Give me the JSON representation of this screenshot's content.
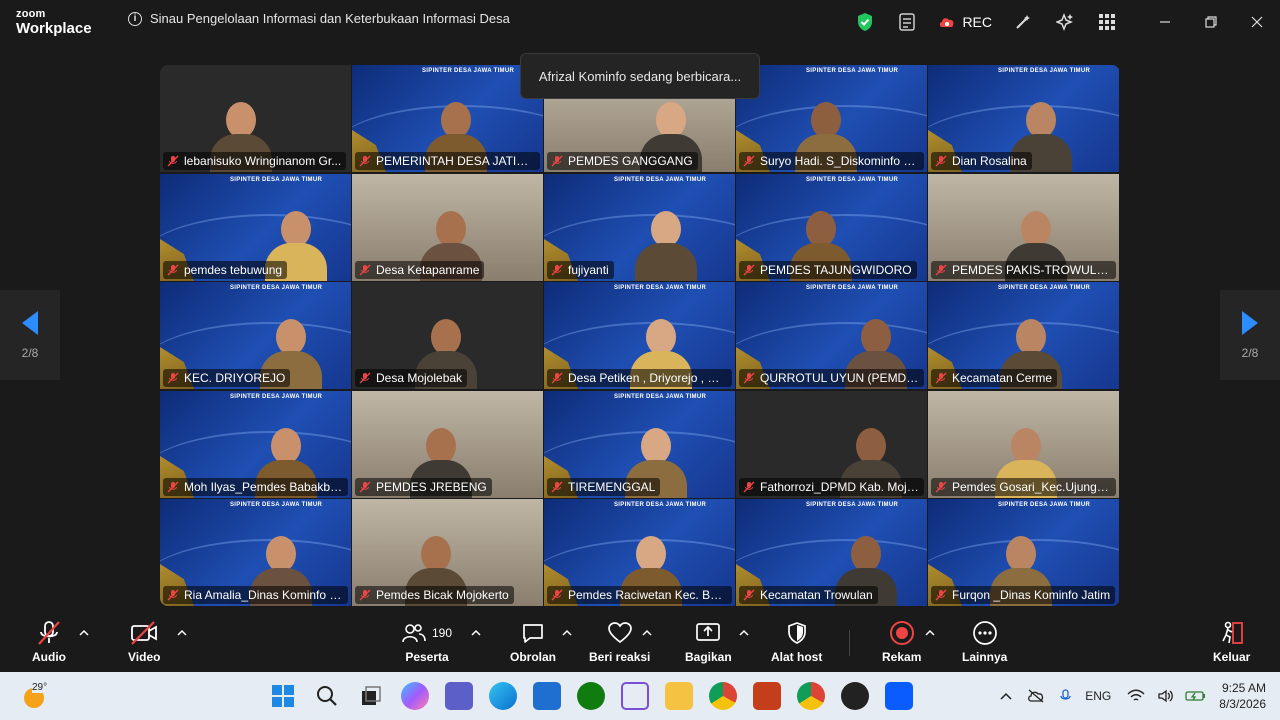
{
  "app": {
    "logo_line1": "zoom",
    "logo_line2": "Workplace",
    "meeting_title": "Sinau Pengelolaan Informasi dan Keterbukaan Informasi Desa",
    "rec_label": "REC",
    "accent_green": "#22c55e",
    "rec_red": "#ef4444"
  },
  "speaker_toast": "Afrizal Kominfo sedang berbicara...",
  "pager": {
    "left_count": "2/8",
    "right_count": "2/8"
  },
  "tile_banner": "SIPINTER DESA JAWA TIMUR",
  "tiles": [
    {
      "name": "lebanisuko Wringinanom Gr...",
      "bg": "dark"
    },
    {
      "name": "PEMERINTAH DESA JATIPAS...",
      "bg": "blue"
    },
    {
      "name": "PEMDES GANGGANG",
      "bg": "room"
    },
    {
      "name": "Suryo Hadi. S_Diskominfo K...",
      "bg": "blue"
    },
    {
      "name": "Dian Rosalina",
      "bg": "blue"
    },
    {
      "name": "pemdes tebuwung",
      "bg": "blue"
    },
    {
      "name": "Desa Ketapanrame",
      "bg": "room"
    },
    {
      "name": "fujiyanti",
      "bg": "blue"
    },
    {
      "name": "PEMDES TAJUNGWIDORO",
      "bg": "blue"
    },
    {
      "name": "PEMDES PAKIS-TROWULAN",
      "bg": "room"
    },
    {
      "name": "KEC. DRIYOREJO",
      "bg": "blue"
    },
    {
      "name": "Desa Mojolebak",
      "bg": "dark"
    },
    {
      "name": "Desa Petiken , Driyorejo , Gr...",
      "bg": "blue"
    },
    {
      "name": "QURROTUL UYUN (PEMDES ...",
      "bg": "blue"
    },
    {
      "name": "Kecamatan Cerme",
      "bg": "blue"
    },
    {
      "name": "Moh Ilyas_Pemdes Babakba...",
      "bg": "blue"
    },
    {
      "name": "PEMDES JREBENG",
      "bg": "room"
    },
    {
      "name": "TIREMENGGAL",
      "bg": "blue"
    },
    {
      "name": "Fathorrozi_DPMD Kab. Mojo...",
      "bg": "dark"
    },
    {
      "name": "Pemdes Gosari_Kec.Ujungpa...",
      "bg": "room"
    },
    {
      "name": "Ria Amalia_Dinas Kominfo P...",
      "bg": "blue"
    },
    {
      "name": "Pemdes Bicak Mojokerto",
      "bg": "room"
    },
    {
      "name": "Pemdes Raciwetan Kec. Bun...",
      "bg": "blue"
    },
    {
      "name": "Kecamatan Trowulan",
      "bg": "blue"
    },
    {
      "name": "Furqon _Dinas Kominfo Jatim",
      "bg": "blue"
    }
  ],
  "toolbar": {
    "audio": "Audio",
    "video": "Video",
    "participants": "Peserta",
    "participant_count": "190",
    "chat": "Obrolan",
    "reactions": "Beri reaksi",
    "share": "Bagikan",
    "host_tools": "Alat host",
    "record": "Rekam",
    "more": "Lainnya",
    "leave": "Keluar"
  },
  "taskbar": {
    "weather_temp": "29°",
    "language": "ENG",
    "time": "9:25 AM",
    "date": "8/3/2026"
  }
}
